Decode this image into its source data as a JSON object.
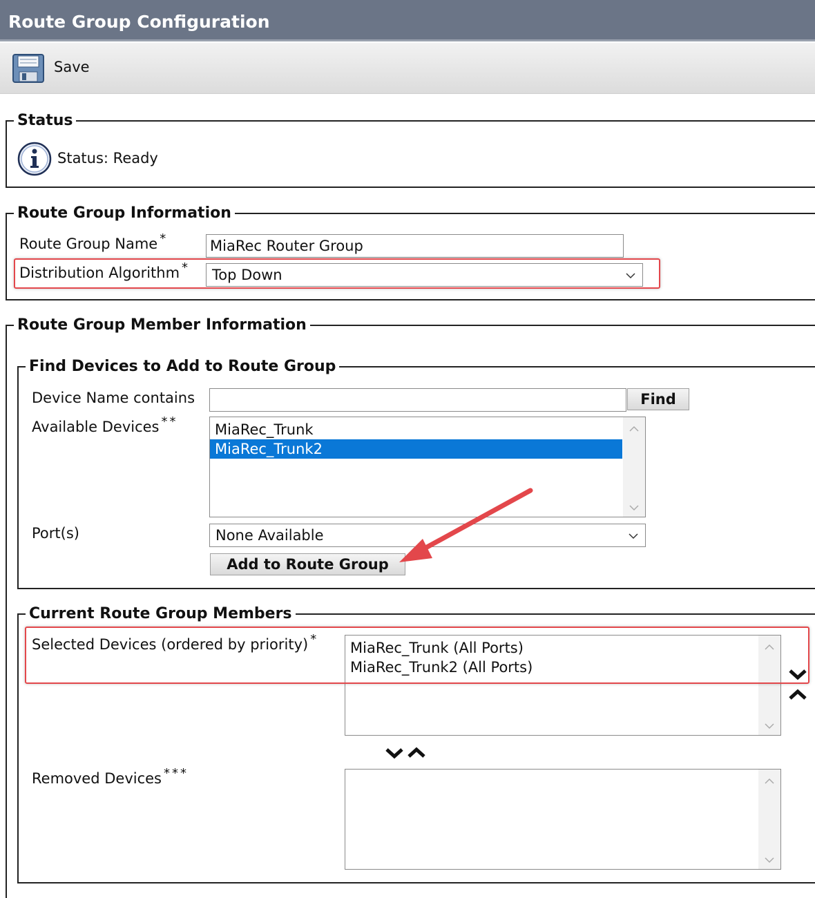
{
  "header": {
    "title": "Route Group Configuration"
  },
  "toolbar": {
    "save_label": "Save",
    "save_icon": "save-icon"
  },
  "status": {
    "legend": "Status",
    "icon": "info-icon",
    "text": "Status: Ready"
  },
  "route_group_info": {
    "legend": "Route Group Information",
    "name_label": "Route Group Name",
    "name_value": "MiaRec Router Group",
    "algorithm_label": "Distribution Algorithm",
    "algorithm_value": "Top Down",
    "required_mark": "*"
  },
  "member_info": {
    "legend": "Route Group Member Information",
    "find": {
      "legend": "Find Devices to Add to Route Group",
      "device_name_label": "Device Name contains",
      "device_name_value": "",
      "find_button": "Find",
      "available_label": "Available Devices",
      "available_mark": "**",
      "available_devices": [
        "MiaRec_Trunk",
        "MiaRec_Trunk2"
      ],
      "selected_available_index": 1,
      "ports_label": "Port(s)",
      "ports_value": "None Available",
      "add_button": "Add to Route Group"
    },
    "current": {
      "legend": "Current Route Group Members",
      "selected_label": "Selected Devices (ordered by priority)",
      "selected_mark": "*",
      "selected_devices": [
        "MiaRec_Trunk (All Ports)",
        "MiaRec_Trunk2 (All Ports)"
      ],
      "removed_label": "Removed Devices",
      "removed_mark": "***"
    }
  },
  "colors": {
    "titlebar": "#6b7587",
    "selection": "#0a78d7",
    "highlight": "#e3474b"
  }
}
